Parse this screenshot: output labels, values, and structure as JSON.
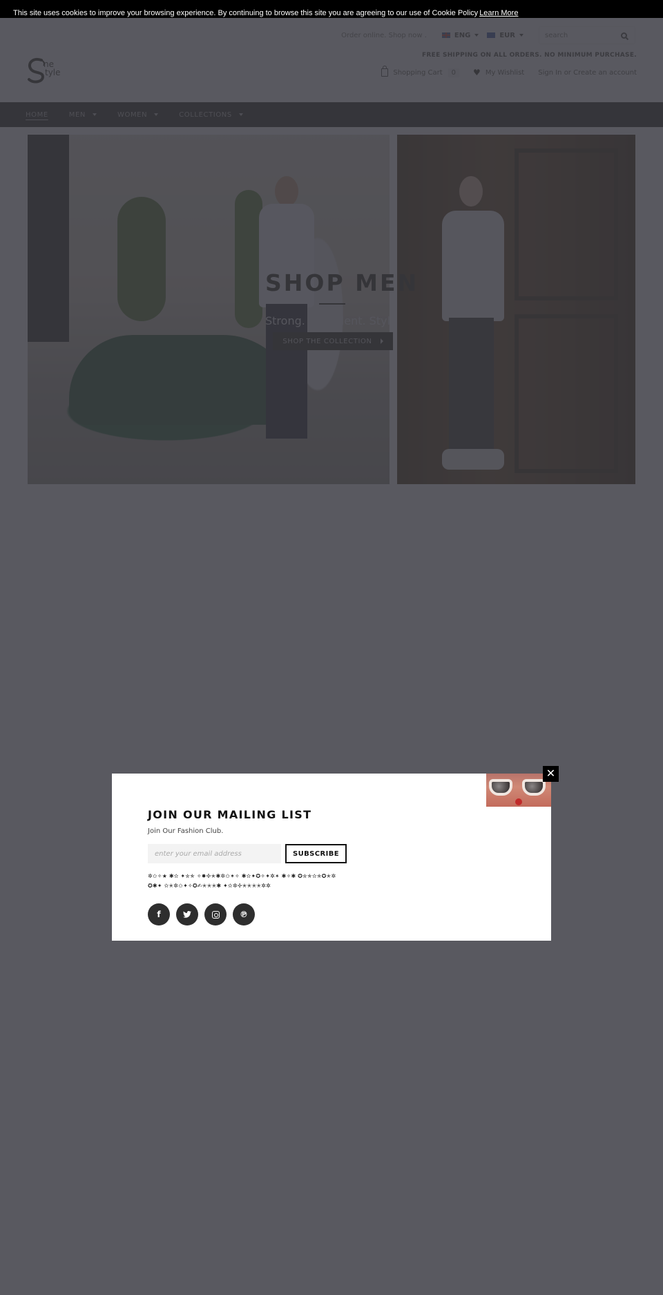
{
  "cookie": {
    "message": "This site uses cookies to improve your browsing experience. By continuing to browse this site you are agreeing to our use of Cookie Policy",
    "link": "Learn More"
  },
  "header": {
    "tagline": "Order online. Shop now .",
    "language": "ENG",
    "currency": "EUR",
    "search_placeholder": "search",
    "free_shipping": "FREE SHIPPING ON ALL ORDERS. NO MINIMUM PURCHASE.",
    "cart_label": "Shopping Cart",
    "cart_count": "0",
    "wishlist_label": "My Wishlist",
    "sign_in": "Sign In",
    "or": "or",
    "create_account": "Create an account",
    "logo_text_1": "ne",
    "logo_text_2": "tyle"
  },
  "nav": {
    "items": [
      {
        "label": "HOME",
        "active": true
      },
      {
        "label": "MEN",
        "dropdown": true
      },
      {
        "label": "WOMEN",
        "dropdown": true
      },
      {
        "label": "COLLECTIONS",
        "dropdown": true
      }
    ]
  },
  "hero": {
    "title": "SHOP MEN",
    "subtitle": "Strong. Confident. Stylish",
    "button": "SHOP THE COLLECTION"
  },
  "modal": {
    "title": "JOIN OUR MAILING LIST",
    "subtitle": "Join Our Fashion Club.",
    "email_placeholder": "enter your email address",
    "subscribe": "SUBSCRIBE",
    "glyph_line_1": "✲✩✧★ ✱✫ ✦✮✯ ✧✸✢✭✱✲✩✶✧ ✱✫✦✪✧✦✲✴ ✱✧✱ ✪✮✯✫✯✪✭✲",
    "glyph_line_2": "✪✱✦ ✫✭✲✩✦✧✪✍✭✭✭✱ ✦✫✲✢✭✭✭✭✲✲",
    "socials": [
      "facebook",
      "twitter",
      "instagram",
      "pinterest"
    ],
    "close": "✕"
  }
}
